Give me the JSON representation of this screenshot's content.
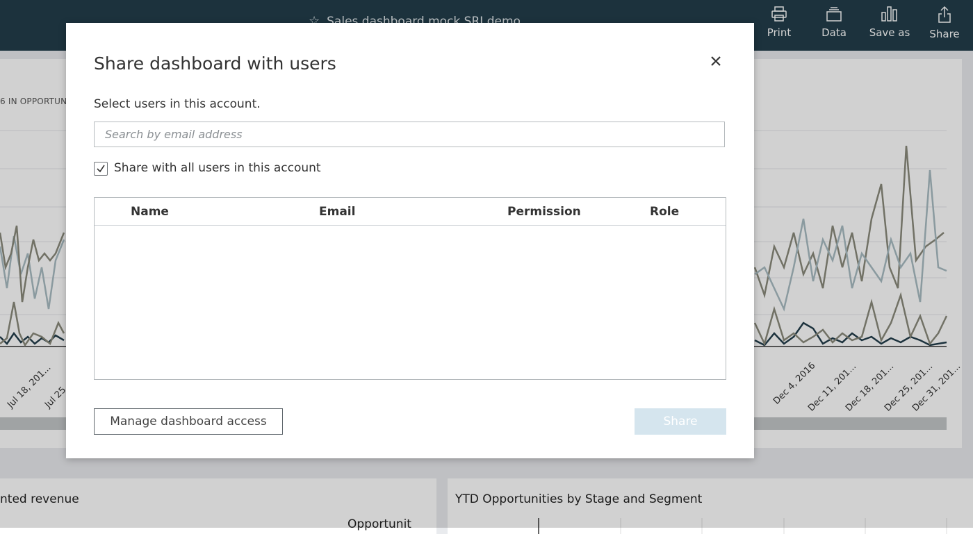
{
  "app": {
    "dashboard_title": "Sales dashboard mock SRI demo",
    "toolbar": {
      "print": "Print",
      "data": "Data",
      "save_as": "Save as",
      "share": "Share"
    },
    "icons": {
      "favorite": "star-icon",
      "print": "printer-icon",
      "data": "data-icon",
      "save_as": "bar-chart-icon",
      "share": "share-icon"
    }
  },
  "background": {
    "top_chart": {
      "subtitle_fragment": "6 IN OPPORTUN",
      "left_ticks": [
        "Jul 18, 201...",
        "Jul 25, 2..."
      ],
      "right_ticks": [
        "Dec 4, 2016",
        "Dec 11, 201...",
        "Dec 18, 201...",
        "Dec 25, 201...",
        "Dec 31, 201..."
      ]
    },
    "card_left": {
      "title_fragment": "nted revenue",
      "column_fragment": "Opportunit"
    },
    "card_right": {
      "title": "YTD Opportunities by Stage and Segment"
    }
  },
  "modal": {
    "title": "Share dashboard with users",
    "instruction": "Select users in this account.",
    "search": {
      "placeholder": "Search by email address",
      "value": ""
    },
    "share_all": {
      "label": "Share with all users in this account",
      "checked": true,
      "check_glyph": "✓"
    },
    "table": {
      "columns": [
        "Name",
        "Email",
        "Permission",
        "Role"
      ],
      "rows": []
    },
    "manage_button": "Manage dashboard access",
    "share_button": "Share",
    "share_button_enabled": false,
    "close_icon": "close-icon"
  },
  "colors": {
    "header_bg": "#233e4b",
    "share_disabled_bg": "#d5e5ee",
    "series_dark": "#233e4b",
    "series_gray": "#8a8a7c",
    "series_light": "#a9bcc3"
  }
}
